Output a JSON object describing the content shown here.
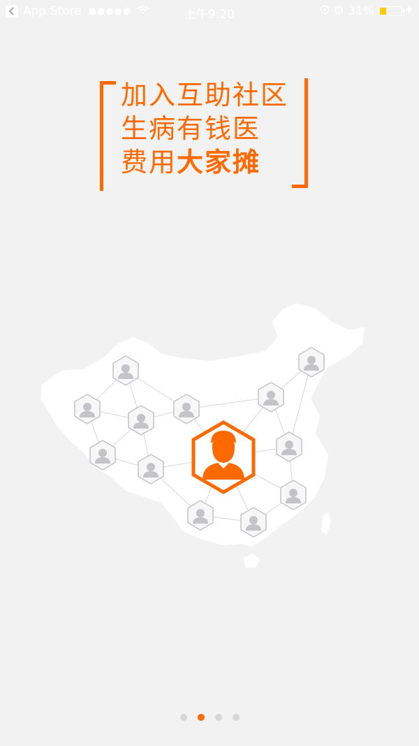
{
  "status_bar": {
    "back_app": "App Store",
    "signal": "●●●●●",
    "time": "上午9:20",
    "battery_percent": "31%",
    "battery_level": 0.31,
    "icons": [
      "back-arrow-icon",
      "wifi-icon",
      "orientation-lock-icon",
      "alarm-icon",
      "battery-icon",
      "charging-icon"
    ]
  },
  "headline": {
    "line1": "加入互助社区",
    "line2": "生病有钱医",
    "line3_normal": "费用",
    "line3_bold": "大家摊"
  },
  "colors": {
    "accent": "#ff6a00",
    "background": "#f2f2f2",
    "node_gray": "#c4c4c8"
  },
  "illustration": {
    "subject": "china-map-network",
    "center_icon": "user-orange-icon",
    "node_icon": "user-gray-icon",
    "node_count": 14
  },
  "pager": {
    "total": 4,
    "active_index": 1
  }
}
